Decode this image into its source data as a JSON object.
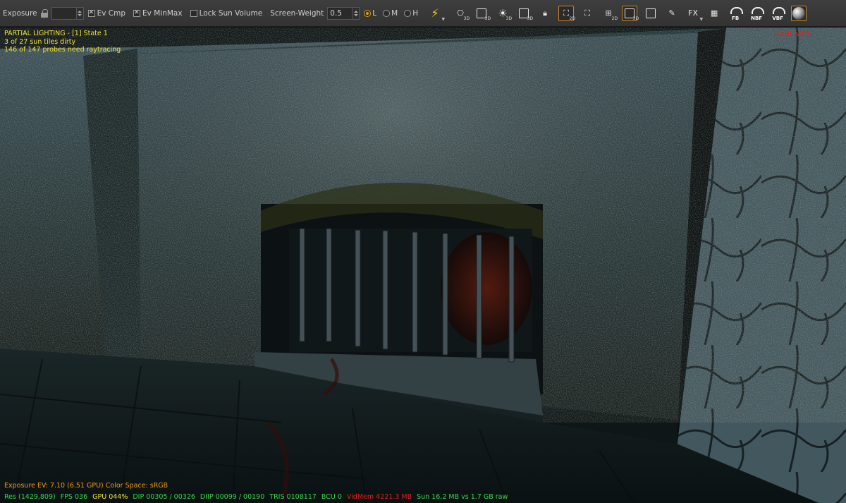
{
  "toolbar": {
    "exposure_label": "Exposure",
    "exposure_value": "",
    "ev_cmp_label": "Ev Cmp",
    "ev_cmp_checked": true,
    "ev_minmax_label": "Ev MinMax",
    "ev_minmax_checked": true,
    "lock_sun_label": "Lock Sun Volume",
    "lock_sun_checked": false,
    "screen_weight_label": "Screen-Weight",
    "screen_weight_value": "0.5",
    "quality_options": [
      "L",
      "M",
      "H"
    ],
    "quality_selected": "L",
    "buttons": {
      "camera_3d": "3D",
      "screen_3d": "3D",
      "light_3d": "3D",
      "lock_3d": "3D",
      "probe_2d_a": "2D",
      "probe_2d_b": "2D",
      "add_2d": "2D",
      "view_3d": "3D",
      "fx": "FX",
      "fb": "FB",
      "nbf": "NBF",
      "vbf": "VBF"
    }
  },
  "overlay": {
    "status_line1": "PARTIAL LIGHTING - [1] State 1",
    "status_line2": "3 of 27 sun tiles dirty",
    "status_line3": "146 of 147 probes need raytracing",
    "game_view": "GAME VIEW",
    "exposure_line": "Exposure EV: 7.10 (6.51 GPU)   Color Space: sRGB"
  },
  "stats": [
    {
      "text": "Res (1429,809)",
      "color": "#35d84a"
    },
    {
      "text": "FPS 036",
      "color": "#35d84a"
    },
    {
      "text": "GPU 044%",
      "color": "#f1e43a"
    },
    {
      "text": "DIP 00305 / 00326",
      "color": "#35d84a"
    },
    {
      "text": "DIIP 00099 / 00190",
      "color": "#35d84a"
    },
    {
      "text": "TRIS 0108117",
      "color": "#35d84a"
    },
    {
      "text": "BCU 0",
      "color": "#35d84a"
    },
    {
      "text": "VidMem 4221.3 MB",
      "color": "#e21f1f"
    },
    {
      "text": "Sun 16.2 MB vs 1.7 GB raw",
      "color": "#35d84a"
    }
  ],
  "colors": {
    "toolbar_bg": "#3a3a3a",
    "active_border": "#c9862a",
    "status_yellow": "#f1e43a",
    "stat_green": "#35d84a",
    "alert_red": "#e21f1f",
    "exposure_orange": "#f09a1a"
  }
}
